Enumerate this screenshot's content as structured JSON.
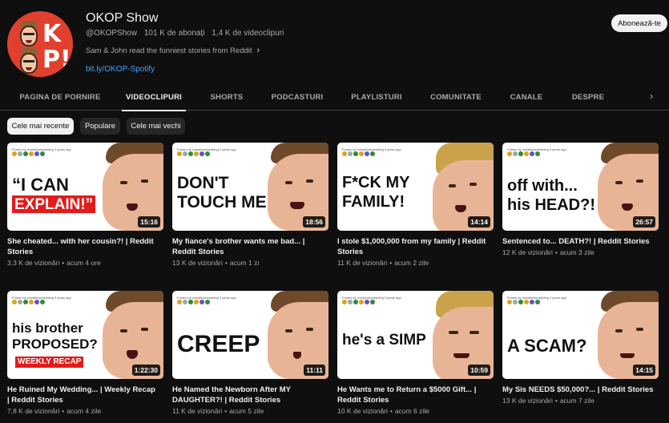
{
  "channel": {
    "avatar_letters": [
      "O",
      "K",
      "P",
      "!"
    ],
    "title": "OKOP Show",
    "handle": "@OKOPShow",
    "subscribers": "101 K de abonați",
    "video_count": "1,4 K de videoclipuri",
    "description": "Sam & John read the funniest stories from Reddit",
    "link": "bit.ly/OKOP-Spotify",
    "subscribe_label": "Abonează-te"
  },
  "tabs": [
    "PAGINA DE PORNIRE",
    "VIDEOCLIPURI",
    "SHORTS",
    "PODCASTURI",
    "PLAYLISTURI",
    "COMUNITATE",
    "CANALE",
    "DESPRE"
  ],
  "active_tab": "VIDEOCLIPURI",
  "filters": [
    "Cele mai recente",
    "Populare",
    "Cele mai vechi"
  ],
  "active_filter": "Cele mai recente",
  "posted_by": "Posted by u/atallhowwedding 3 years ago",
  "colors": {
    "accent_red": "#e21b1b",
    "link_blue": "#3ea6ff",
    "background": "#0f0f0f"
  },
  "videos": [
    {
      "thumb_lines": [
        "“I CAN",
        "EXPLAIN!”"
      ],
      "duration": "15:16",
      "title": "She cheated... with her cousin?! | Reddit Stories",
      "views": "3,3 K de vizionări",
      "age": "acum 4 ore"
    },
    {
      "thumb_lines": [
        "DON'T",
        "TOUCH ME!"
      ],
      "duration": "18:56",
      "title": "My fiance's brother wants me bad... | Reddit Stories",
      "views": "13 K de vizionări",
      "age": "acum 1 zi"
    },
    {
      "thumb_lines": [
        "F*CK MY",
        "FAMILY!"
      ],
      "duration": "14:14",
      "title": "I stole $1,000,000 from my family | Reddit Stories",
      "views": "11 K de vizionări",
      "age": "acum 2 zile"
    },
    {
      "thumb_lines": [
        "off with...",
        "his HEAD?!"
      ],
      "duration": "26:57",
      "title": "Sentenced to... DEATH?! | Reddit Stories",
      "views": "12 K de vizionări",
      "age": "acum 3 zile"
    },
    {
      "thumb_lines": [
        "his brother",
        "PROPOSED?",
        "WEEKLY RECAP"
      ],
      "duration": "1:22:30",
      "title": "He Ruined My Wedding... | Weekly Recap | Reddit Stories",
      "views": "7,8 K de vizionări",
      "age": "acum 4 zile"
    },
    {
      "thumb_lines": [
        "CREEP"
      ],
      "duration": "11:11",
      "title": "He Named the Newborn After MY DAUGHTER?! | Reddit Stories",
      "views": "11 K de vizionări",
      "age": "acum 5 zile"
    },
    {
      "thumb_lines": [
        "he's a SIMP"
      ],
      "duration": "10:59",
      "title": "He Wants me to Return a $5000 Gift... | Reddit Stories",
      "views": "10 K de vizionări",
      "age": "acum 6 zile"
    },
    {
      "thumb_lines": [
        "A SCAM?"
      ],
      "duration": "14:15",
      "title": "My Sis NEEDS $50,000?... | Reddit Stories",
      "views": "13 K de vizionări",
      "age": "acum 7 zile"
    }
  ]
}
